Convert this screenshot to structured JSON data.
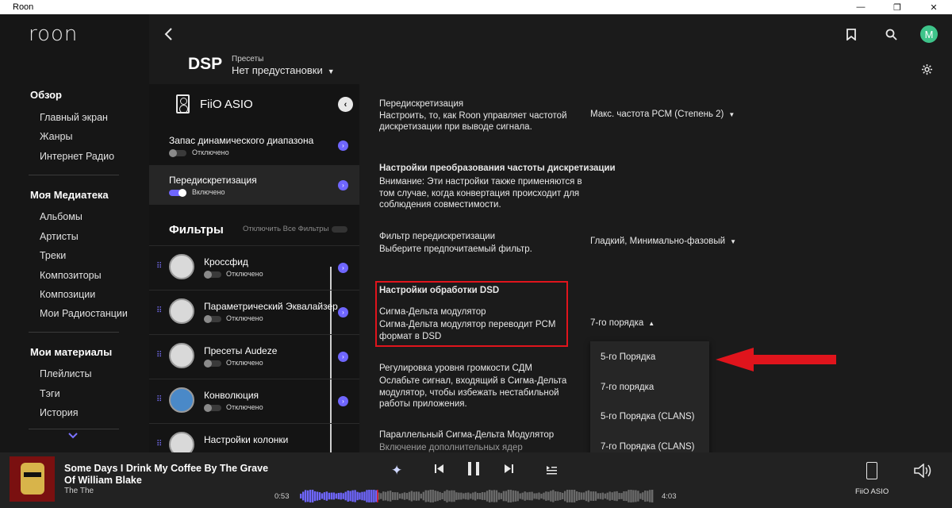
{
  "window": {
    "title": "Roon",
    "minimize": "—",
    "maximize": "❐",
    "close": "✕"
  },
  "nav": {
    "logo": "roon",
    "sections": [
      {
        "title": "Обзор",
        "items": [
          "Главный экран",
          "Жанры",
          "Интернет Радио"
        ]
      },
      {
        "title": "Моя Медиатека",
        "items": [
          "Альбомы",
          "Артисты",
          "Треки",
          "Композиторы",
          "Композиции",
          "Мои Радиостанции"
        ]
      },
      {
        "title": "Мои материалы",
        "items": [
          "Плейлисты",
          "Тэги",
          "История"
        ]
      }
    ],
    "more_icon": "chevron-down-icon"
  },
  "header": {
    "title": "DSP",
    "presets_label": "Пресеты",
    "presets_value": "Нет предустановки",
    "avatar_letter": "M",
    "avatar_color": "#3ec48a"
  },
  "device": {
    "name": "FiiO ASIO",
    "rows": [
      {
        "name": "Запас динамического диапазона",
        "status": "Отключено",
        "enabled": false
      },
      {
        "name": "Передискретизация",
        "status": "Включено",
        "enabled": true
      }
    ],
    "filters_title": "Фильтры",
    "disable_all_label": "Отключить Все Фильтры",
    "filters": [
      {
        "name": "Кроссфид",
        "status": "Отключено"
      },
      {
        "name": "Параметрический Эквалайзер",
        "status": "Отключено"
      },
      {
        "name": "Пресеты Audeze",
        "status": "Отключено"
      },
      {
        "name": "Конволюция",
        "status": "Отключено"
      },
      {
        "name": "Настройки колонки",
        "status": ""
      }
    ]
  },
  "settings": {
    "oversampling_title": "Передискретизация",
    "oversampling_desc_1": "Настроить, то, как Roon управляет частотой",
    "oversampling_desc_2": "дискретизации при выводе сигнала.",
    "oversampling_value": "Макс. частота PCM (Степень 2)",
    "src_title": "Настройки преобразования частоты дискретизации",
    "src_desc_1": "Внимание: Эти настройки также применяются в",
    "src_desc_2": "том случае, когда конвертация происходит для",
    "src_desc_3": "соблюдения совместимости.",
    "filter_title": "Фильтр передискретизации",
    "filter_desc": "Выберите предпочитаемый фильтр.",
    "filter_value": "Гладкий, Минимально-фазовый",
    "dsd_title": "Настройки обработки DSD",
    "sdm_title": "Сигма-Дельта модулятор",
    "sdm_desc_1": "Сигма-Дельта модулятор переводит PCM",
    "sdm_desc_2": "формат в DSD",
    "sdm_value": "7-го порядка",
    "gain_title": "Регулировка уровня громкости СДМ",
    "gain_desc_1": "Ослабьте сигнал, входящий в Сигма-Дельта",
    "gain_desc_2": "модулятор, чтобы избежать нестабильной",
    "gain_desc_3": "работы приложения.",
    "parallel_title": "Параллельный Сигма-Дельта Модулятор",
    "parallel_desc": "Включение дополнительных ядер",
    "dropdown_options": [
      "5-го Порядка",
      "7-го порядка",
      "5-го Порядка (CLANS)",
      "7-го Порядка (CLANS)"
    ],
    "highlight_color": "#e0141c"
  },
  "player": {
    "track_title": "Some Days I Drink My Coffee By The Grave Of William Blake",
    "artist": "The The",
    "elapsed": "0:53",
    "duration": "4:03",
    "progress": 0.218,
    "zone": "FiiO ASIO",
    "accent_color": "#6f66ff"
  }
}
